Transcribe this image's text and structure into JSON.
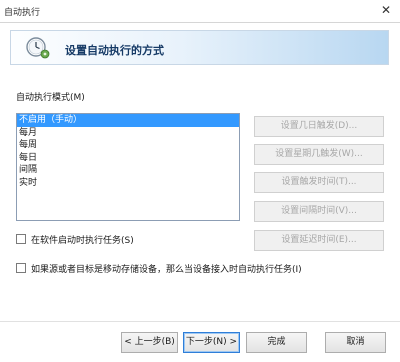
{
  "window": {
    "title": "自动执行",
    "close_glyph": "✕"
  },
  "banner": {
    "title": "设置自动执行的方式",
    "icon": "clock-gear-icon"
  },
  "mode": {
    "label": "自动执行模式(M)",
    "options": [
      "不启用（手动）",
      "每月",
      "每周",
      "每日",
      "间隔",
      "实时"
    ],
    "selected_index": 0
  },
  "side_buttons": [
    {
      "label": "设置几日触发(D)...",
      "enabled": false
    },
    {
      "label": "设置星期几触发(W)...",
      "enabled": false
    },
    {
      "label": "设置触发时间(T)...",
      "enabled": false
    },
    {
      "label": "设置间隔时间(V)...",
      "enabled": false
    },
    {
      "label": "设置延迟时间(E)...",
      "enabled": false
    }
  ],
  "checkboxes": {
    "run_on_start": {
      "label": "在软件启动时执行任务(S)",
      "checked": false
    },
    "removable_device": {
      "label": "如果源或者目标是移动存储设备，那么当设备接入时自动执行任务(I)",
      "checked": false
    }
  },
  "footer": {
    "back_label": "< 上一步(B)",
    "next_label": "下一步(N) >",
    "finish_label": "完成",
    "cancel_label": "取消"
  },
  "colors": {
    "selection": "#3399ff",
    "banner_gradient_end": "#b8d7f1",
    "disabled_text": "#a7a7a7"
  }
}
